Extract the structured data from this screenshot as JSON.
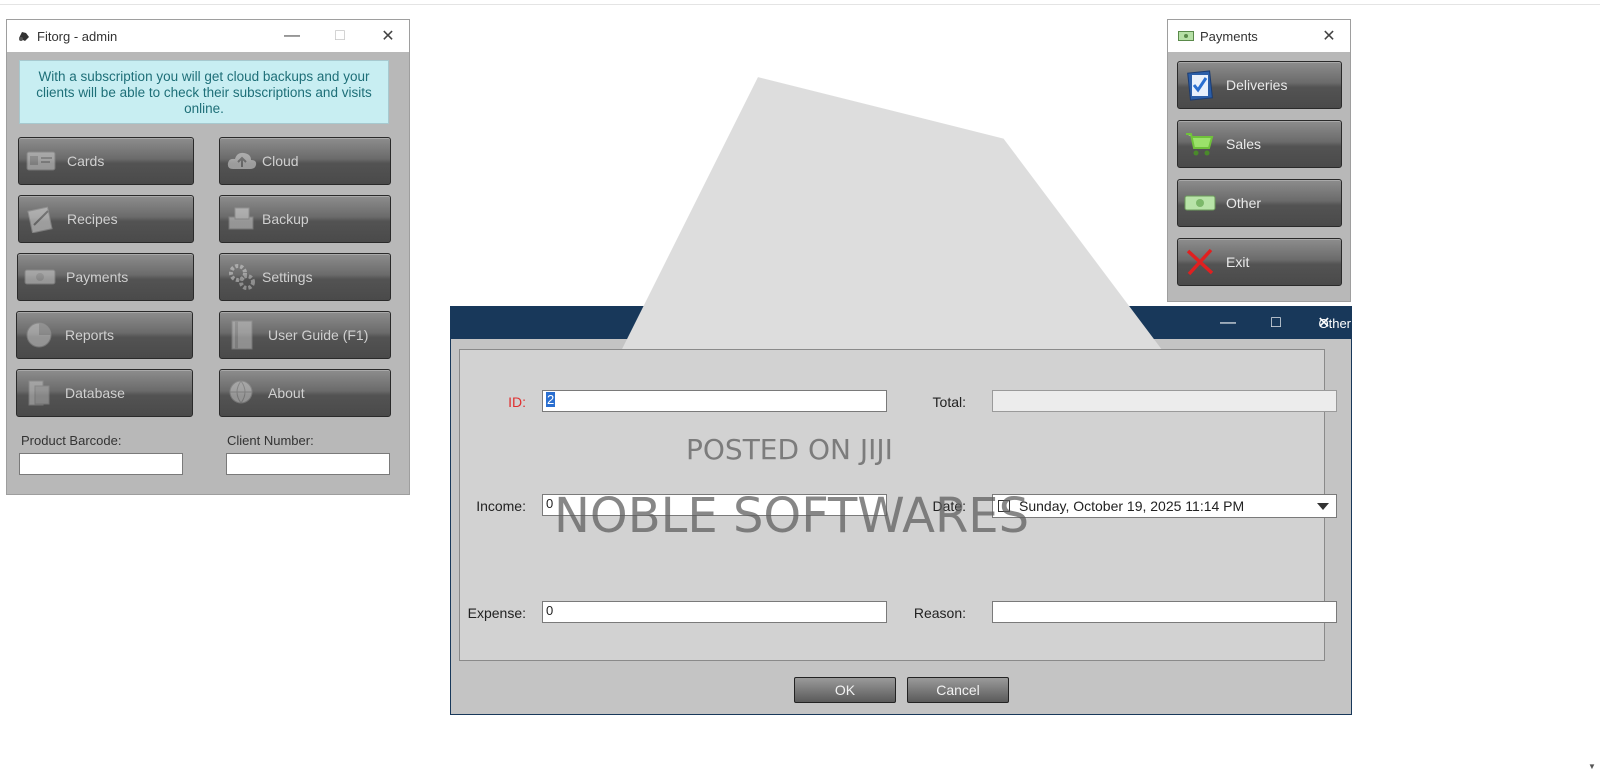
{
  "main_window": {
    "title": "Fitorg - admin",
    "info_text": "With a subscription you will get cloud backups and your clients will be able to check their subscriptions and visits online.",
    "buttons": {
      "cards": "Cards",
      "cloud": "Cloud",
      "recipes": "Recipes",
      "backup": "Backup",
      "payments": "Payments",
      "settings": "Settings",
      "reports": "Reports",
      "user_guide": "User Guide (F1)",
      "database": "Database",
      "about": "About"
    },
    "product_barcode_label": "Product Barcode:",
    "product_barcode_value": "",
    "client_number_label": "Client Number:",
    "client_number_value": ""
  },
  "payments_window": {
    "title": "Payments",
    "buttons": {
      "deliveries": "Deliveries",
      "sales": "Sales",
      "other": "Other",
      "exit": "Exit"
    }
  },
  "other_dialog": {
    "title": "Other",
    "id_label": "ID:",
    "id_value": "2",
    "total_label": "Total:",
    "total_value": "",
    "income_label": "Income:",
    "income_value": "0",
    "date_label": "Date:",
    "date_value": "Sunday, October 19, 2025 11:14 PM",
    "expense_label": "Expense:",
    "expense_value": "0",
    "reason_label": "Reason:",
    "reason_value": "",
    "ok_label": "OK",
    "cancel_label": "Cancel"
  },
  "watermarks": {
    "line1": "POSTED ON JIJI",
    "line2": "NOBLE SOFTWARES"
  },
  "icons": [
    "app-icon",
    "id-card-icon",
    "cloud-icon",
    "recipe-icon",
    "backup-icon",
    "money-icon",
    "settings-icon",
    "pie-chart-icon",
    "book-icon",
    "database-icon",
    "globe-icon",
    "checklist-icon",
    "cart-icon",
    "exit-x-icon"
  ]
}
